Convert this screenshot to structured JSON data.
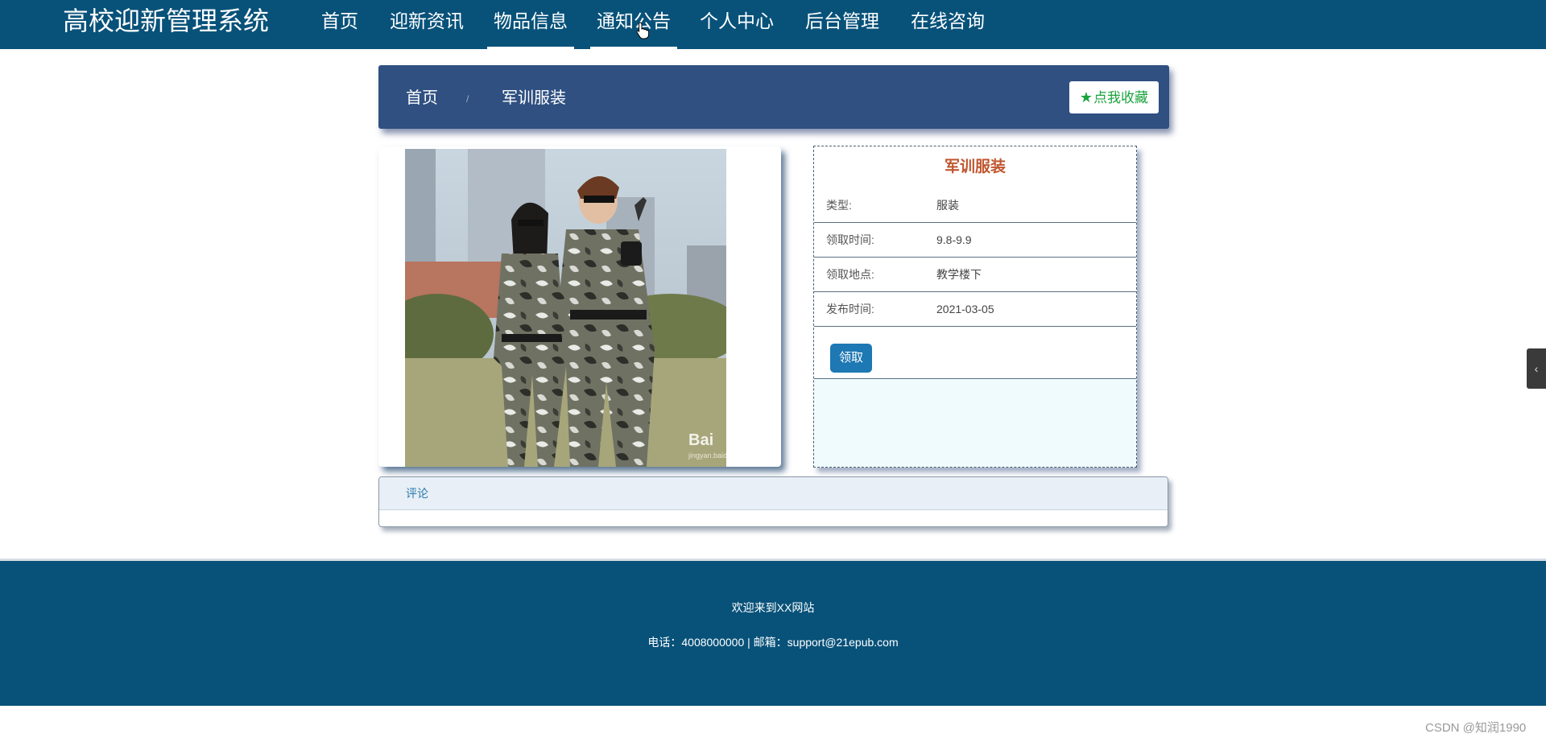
{
  "app": {
    "title": "高校迎新管理系统"
  },
  "nav": {
    "items": [
      {
        "label": "首页"
      },
      {
        "label": "迎新资讯"
      },
      {
        "label": "物品信息"
      },
      {
        "label": "通知公告"
      },
      {
        "label": "个人中心"
      },
      {
        "label": "后台管理"
      },
      {
        "label": "在线咨询"
      }
    ],
    "active": [
      "物品信息",
      "通知公告"
    ]
  },
  "breadcrumb": {
    "home": "首页",
    "separator": "/",
    "current": "军训服装"
  },
  "favorite": {
    "label": "点我收藏",
    "icon": "star-icon"
  },
  "photo": {
    "watermark_brand": "Bai",
    "watermark_sub": "jingyan.baidu.com"
  },
  "detail": {
    "title": "军训服装",
    "rows": [
      {
        "key": "类型:",
        "value": "服装"
      },
      {
        "key": "领取时间:",
        "value": "9.8-9.9"
      },
      {
        "key": "领取地点:",
        "value": "教学楼下"
      },
      {
        "key": "发布时间:",
        "value": "2021-03-05"
      }
    ],
    "action_label": "领取"
  },
  "comments": {
    "label": "评论"
  },
  "footer": {
    "welcome": "欢迎来到XX网站",
    "contact": "电话：4008000000 | 邮箱：support@21epub.com"
  },
  "side_toggle": {
    "icon": "chevron-left-icon",
    "glyph": "‹"
  },
  "watermark": "CSDN @知润1990",
  "colors": {
    "header": "#08527a",
    "breadcrumb_bar": "#2f5081",
    "favorite_text": "#1aa33c",
    "detail_title": "#c0562f",
    "primary_button": "#1d78b3"
  }
}
